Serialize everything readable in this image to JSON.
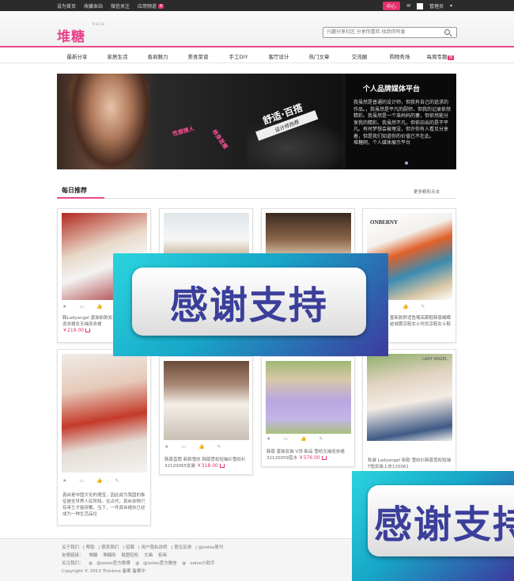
{
  "topbar": {
    "links": [
      "设为首页",
      "收藏本站",
      "微信关注",
      "应用频道"
    ],
    "badge": "8",
    "center": "中心",
    "user": "管理员"
  },
  "header": {
    "logo": "堆糖",
    "beta": "beta",
    "search_placeholder": "兴趣分享社区 分享你喜欢·找到你所爱"
  },
  "nav": {
    "items": [
      "最新分享",
      "家居生活",
      "香肩魅力",
      "美食菜谱",
      "手工DIY",
      "客厅设计",
      "热门文章",
      "交流圈",
      "购物秀场",
      "每周专题"
    ],
    "hot_badge": "热"
  },
  "banner": {
    "tag1": "性感撩人",
    "tag2": "修身显瘦",
    "slogan_main": "舒适·百搭",
    "slogan_sub": "设计师热荐",
    "heading": "个人品牌媒体平台",
    "body": "我虽然是普通的设计师，但我有自己的追求的作品。，我虽然是平凡的厨师，但我的记录依然精彩。我虽然是一个准妈妈的妻，但依然能分享我的精彩。我虽然不凡，但依旧出的是不平凡。有时梦想会被埋没，但许你有人看见分享着，但是我们知道你的价值已不在此。",
    "tagline": "堆糖网，个人媒体展示平台"
  },
  "section": {
    "title": "每日推荐",
    "more": "更多精彩点击"
  },
  "cards": [
    {
      "desc": "韩Ladyangel 夏装新款女装韩版清爽款通勤连衣裙女无袖连衣裙",
      "price": "￥219.00"
    },
    {
      "desc": "",
      "price": ""
    },
    {
      "desc": "",
      "price": ""
    },
    {
      "desc": "夏新款舒适鱼嘴高跟鞋韩版蝴蝶结坡跟凉鞋女士时尚凉鞋女士鞋",
      "price": ""
    },
    {
      "desc": "真丝是中国文化的瑰宝，因此成为我国的象征被全世界人民所知。在古代，真丝衣物只有帝王才能穿戴，当下，一件真丝裙衣已经成为一种生活品位",
      "price": ""
    },
    {
      "desc": "韩版直筒 新款雪纺 韩版宽松短袖衫雪纺衫32120065女装",
      "price": "￥318.00"
    },
    {
      "desc": "韩版 夏装女装 V领 新品 雪纺无袖连衣裙32120059蓝水",
      "price": "￥576.00"
    },
    {
      "desc": "秋装 Ladyangel 新款 雪纺衫韩版宽松短袖T恤女装上衣120061",
      "price": ""
    }
  ],
  "overlay_text": "感谢支持",
  "footer": {
    "row1": [
      "关于我们",
      "帮助",
      "联系我们",
      "招聘",
      "用户隐私说明",
      "意见反馈",
      "@ooloo周刊"
    ],
    "row2_label": "友情链接：",
    "row2": [
      "堆糖",
      "堆糖网",
      "易图轻松",
      "文画",
      "拓画"
    ],
    "row3_label": "关注我们：",
    "row3": [
      "@ooloo官方微博",
      "@ooloo官方微信",
      "ooloo小助手"
    ],
    "copyright": "Copyright © 2013 Thinkms 备案 备案中"
  },
  "colors": {
    "accent": "#e3306c",
    "overlay_blue": "#3b3f9a",
    "overlay_cyan": "#17a6c8"
  }
}
